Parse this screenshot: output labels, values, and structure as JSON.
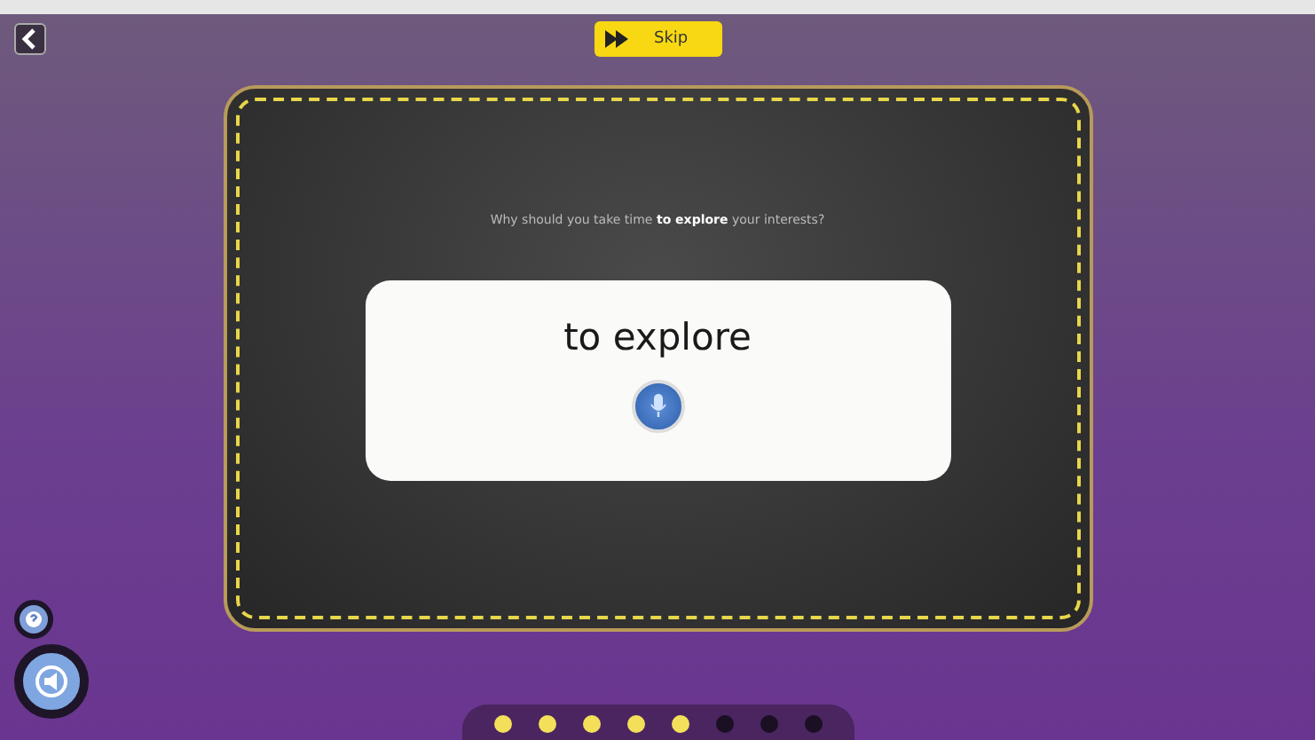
{
  "skip_button": {
    "label": "Skip"
  },
  "question": "Why should you take time **to explore** your interests?",
  "answer_card": {
    "word": "to explore"
  },
  "progress": [
    {
      "done": true
    },
    {
      "done": true
    },
    {
      "done": true
    },
    {
      "done": true
    },
    {
      "done": true
    },
    {
      "done": false
    },
    {
      "done": false
    },
    {
      "done": false
    }
  ]
}
